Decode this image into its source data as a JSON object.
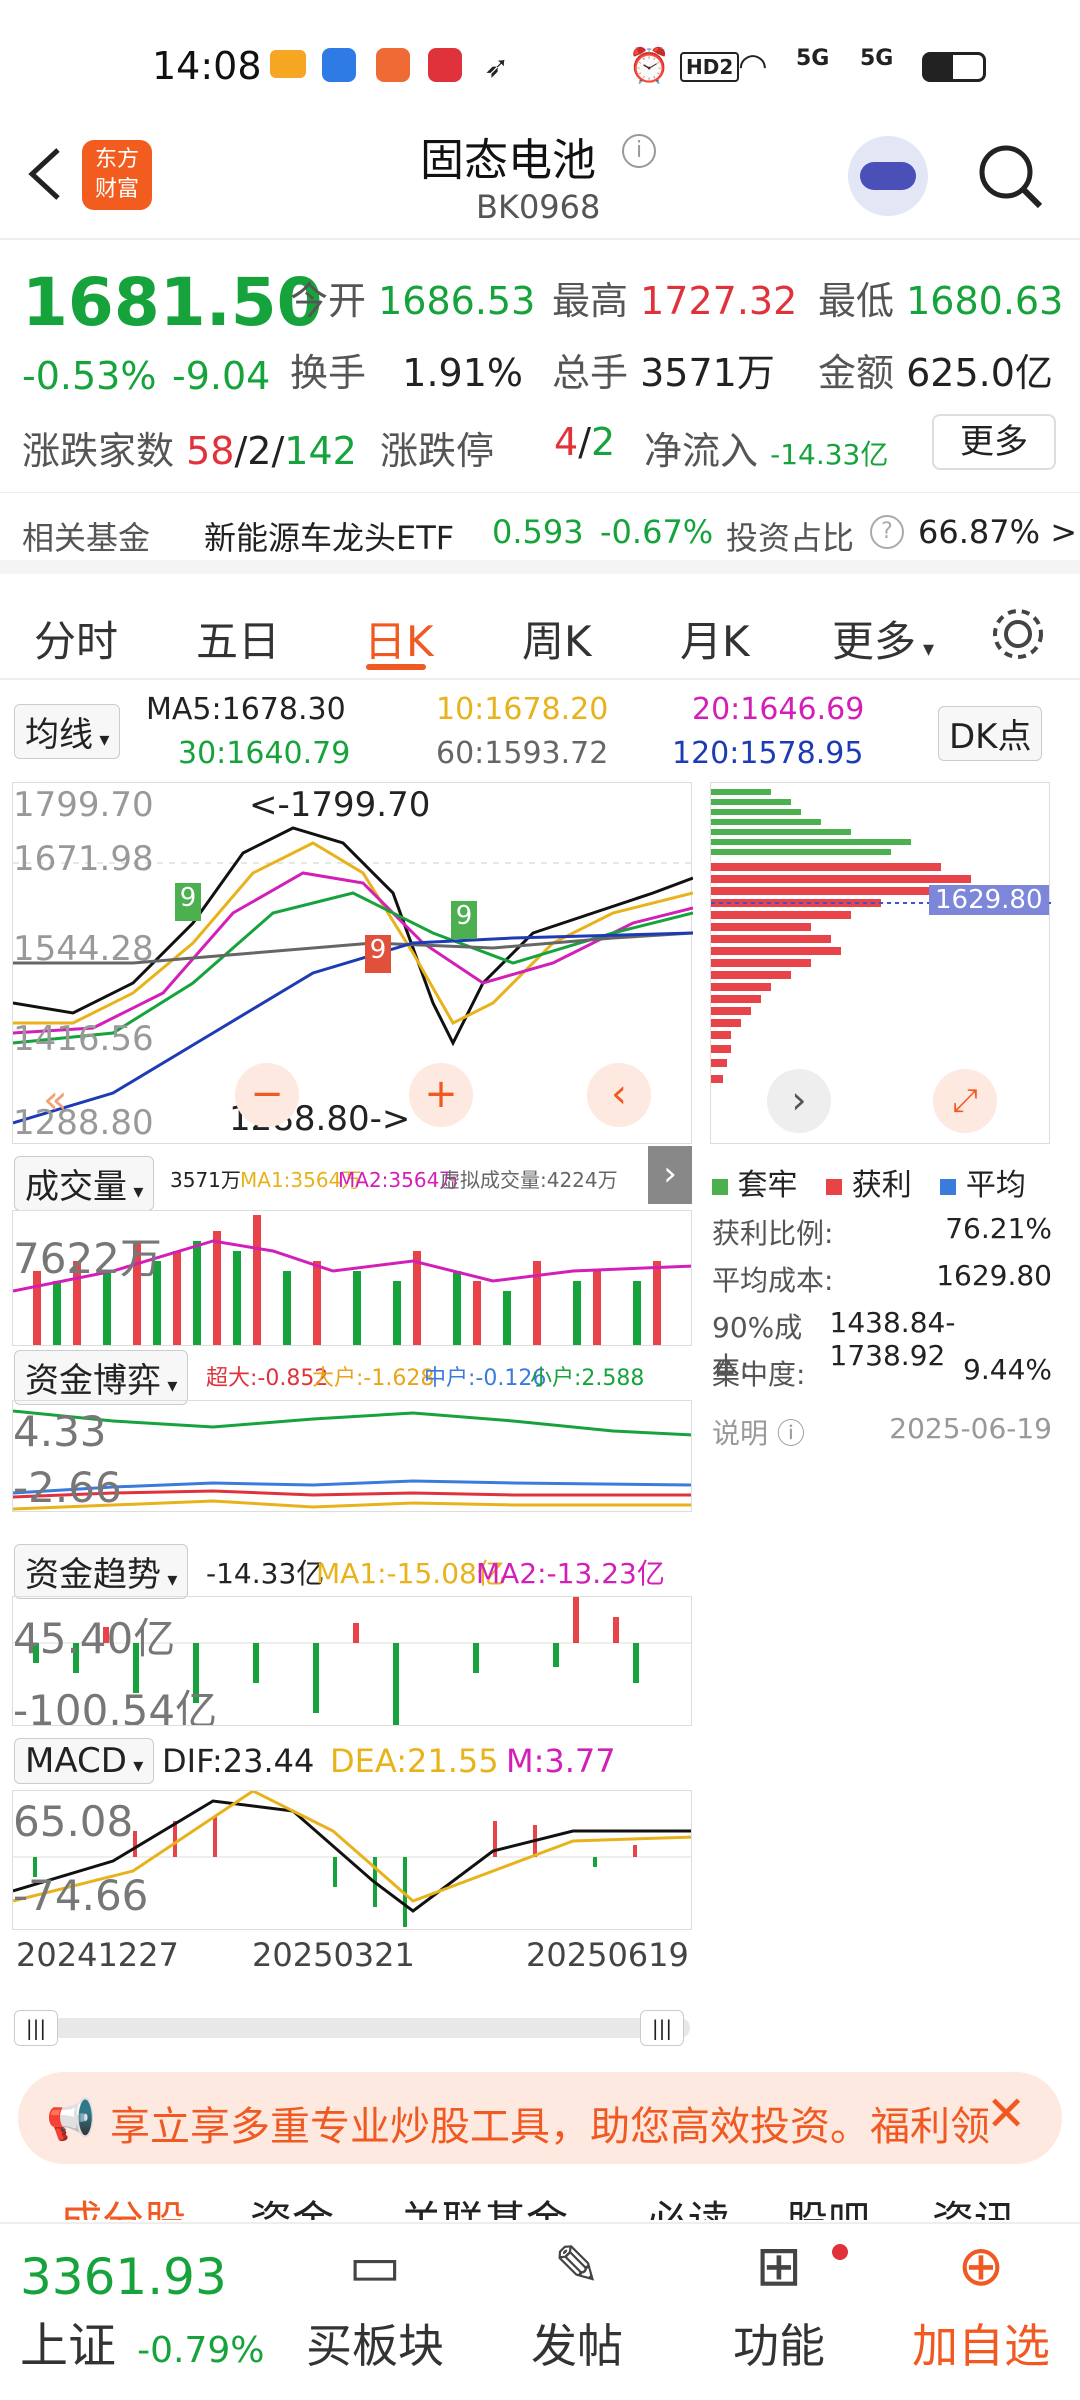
{
  "status_bar": {
    "time": "14:08",
    "hd": "HD2",
    "net1": "5G",
    "net2": "5G"
  },
  "nav": {
    "logo_line1": "东方",
    "logo_line2": "财富",
    "title": "固态电池",
    "code": "BK0968"
  },
  "quote": {
    "price": "1681.50",
    "change_pct": "-0.53%",
    "change": "-9.04",
    "open_label": "今开",
    "open": "1686.53",
    "high_label": "最高",
    "high": "1727.32",
    "low_label": "最低",
    "low": "1680.63",
    "turnover_label": "换手",
    "turnover": "1.91%",
    "volume_label": "总手",
    "volume": "3571万",
    "amount_label": "金额",
    "amount": "625.0亿",
    "updown_label": "涨跌家数",
    "up": "58",
    "flat": "2",
    "down": "142",
    "sep": "/",
    "limit_label": "涨跌停",
    "limit_up": "4",
    "limit_down": "2",
    "netflow_label": "净流入",
    "netflow": "-14.33亿",
    "more": "更多"
  },
  "fund": {
    "label": "相关基金",
    "name": "新能源车龙头ETF",
    "price": "0.593",
    "pct": "-0.67%",
    "ratio_label": "投资占比",
    "ratio": "66.87% >"
  },
  "tabs": {
    "items": [
      "分时",
      "五日",
      "日K",
      "周K",
      "月K",
      "更多"
    ],
    "active": "日K"
  },
  "ma": {
    "select": "均线",
    "ma5": "MA5:1678.30",
    "ma10": "10:1678.20",
    "ma20": "20:1646.69",
    "ma30": "30:1640.79",
    "ma60": "60:1593.72",
    "ma120": "120:1578.95",
    "dk": "DK点"
  },
  "kline": {
    "top": "1799.70",
    "mid1": "1671.98",
    "mid2": "1544.28",
    "mid3": "1416.56",
    "bottom": "1288.80",
    "max_mark": "<-1799.70",
    "min_mark": "1288.80->"
  },
  "chips": {
    "cost_label": "1629.80",
    "legend": [
      "套牢",
      "获利",
      "平均"
    ],
    "rows": [
      {
        "k": "获利比例:",
        "v": "76.21%"
      },
      {
        "k": "平均成本:",
        "v": "1629.80"
      },
      {
        "k": "90%成本:",
        "v": "1438.84-1738.92"
      },
      {
        "k": "集中度:",
        "v": "9.44%"
      }
    ],
    "note": "说明",
    "date": "2025-06-19"
  },
  "volume": {
    "select": "成交量",
    "vol": "3571万",
    "ma1": "MA1:3564万",
    "ma2": "MA2:3564万",
    "virtual": "虚拟成交量:4224万",
    "max": "7622万"
  },
  "game": {
    "select": "资金博弈",
    "big": "超大:-0.852",
    "large": "大户:-1.628",
    "mid": "中户:-0.126",
    "small": "小户:2.588",
    "top": "4.33",
    "bottom": "-2.66"
  },
  "trend": {
    "select": "资金趋势",
    "v": "-14.33亿",
    "ma1": "MA1:-15.08亿",
    "ma2": "MA2:-13.23亿",
    "top": "45.40亿",
    "bottom": "-100.54亿"
  },
  "macd": {
    "select": "MACD",
    "dif": "DIF:23.44",
    "dea": "DEA:21.55",
    "m": "M:3.77",
    "top": "65.08",
    "bottom": "-74.66"
  },
  "dates": [
    "20241227",
    "20250321",
    "20250619"
  ],
  "banner": {
    "text": "享立享多重专业炒股工具，助您高效投资。福利领"
  },
  "subtabs": [
    "成分股",
    "资金",
    "关联基金",
    "必读",
    "股吧",
    "资讯"
  ],
  "bottom": {
    "index": "3361.93",
    "index_name": "上证",
    "index_pct": "-0.79%",
    "items": [
      "买板块",
      "发帖",
      "功能",
      "加自选"
    ]
  }
}
